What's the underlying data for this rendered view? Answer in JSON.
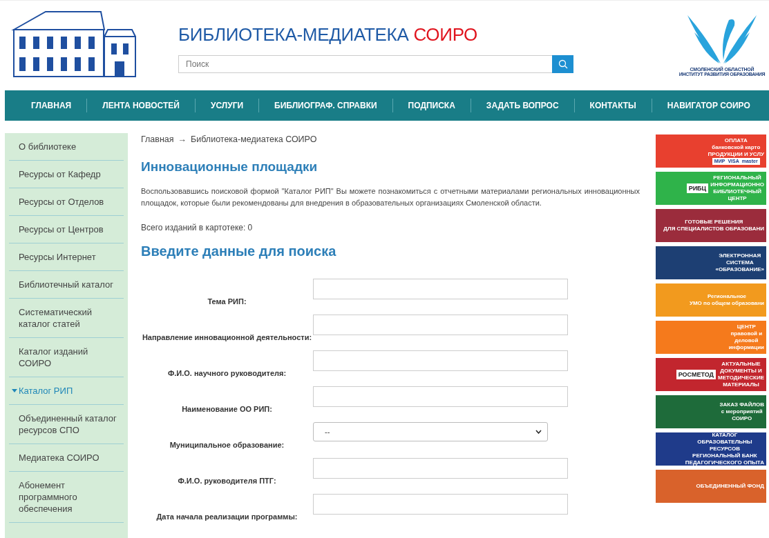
{
  "header": {
    "title": "БИБЛИОТЕКА-МЕДИАТЕКА",
    "title_accent": "СОИРО",
    "search": {
      "placeholder": "Поиск"
    },
    "org_lines": [
      "СМОЛЕНСКИЙ ОБЛАСТНОЙ",
      "ИНСТИТУТ РАЗВИТИЯ ОБРАЗОВАНИЯ"
    ]
  },
  "nav": [
    "ГЛАВНАЯ",
    "ЛЕНТА НОВОСТЕЙ",
    "УСЛУГИ",
    "БИБЛИОГРАФ. СПРАВКИ",
    "ПОДПИСКА",
    "ЗАДАТЬ ВОПРОС",
    "КОНТАКТЫ",
    "НАВИГАТОР СОИРО"
  ],
  "sidebar": {
    "items": [
      {
        "label": "О библиотеке",
        "selected": false
      },
      {
        "label": "Ресурсы от Кафедр",
        "selected": false
      },
      {
        "label": "Ресурсы от Отделов",
        "selected": false
      },
      {
        "label": "Ресурсы от Центров",
        "selected": false
      },
      {
        "label": "Ресурсы Интернет",
        "selected": false
      },
      {
        "label": "Библиотечный каталог",
        "selected": false
      },
      {
        "label": "Систематический каталог статей",
        "selected": false
      },
      {
        "label": "Каталог изданий СОИРО",
        "selected": false
      },
      {
        "label": "Каталог РИП",
        "selected": true
      },
      {
        "label": "Объединенный каталог ресурсов СПО",
        "selected": false
      },
      {
        "label": "Медиатека СОИРО",
        "selected": false
      },
      {
        "label": "Абонемент программного обеспечения",
        "selected": false
      }
    ]
  },
  "breadcrumb": [
    "Главная",
    "→",
    "Библиотека-медиатека СОИРО"
  ],
  "heading": "Инновационные площадки",
  "intro": "Воспользовавшись поисковой формой \"Каталог РИП\" Вы можете познакомиться с отчетными материалами региональных инновационных площадок, которые были рекомендованы для внедрения в образовательных организациях Смоленской области.",
  "count": "Всего изданий в картотеке: 0",
  "form": {
    "title": "Введите данные для поиска",
    "fields": [
      {
        "label": "Тема РИП:",
        "kind": "text"
      },
      {
        "label": "Направление инновационной деятельности:",
        "kind": "text"
      },
      {
        "label": "Ф.И.О. научного руководителя:",
        "kind": "text"
      },
      {
        "label": "Наименование ОО РИП:",
        "kind": "text"
      },
      {
        "label": "Муниципальное образование:",
        "kind": "select",
        "value": "--"
      },
      {
        "label": "Ф.И.О. руководителя ПТГ:",
        "kind": "text"
      },
      {
        "label": "Дата начала реализации программы:",
        "kind": "text"
      }
    ]
  },
  "banners": [
    {
      "color": "#e8402f",
      "lines": [
        "ОПЛАТА",
        "банковской карто",
        "ПРОДУКЦИИ И УСЛУ"
      ],
      "footer": [
        "МИР",
        "VISA",
        "master"
      ]
    },
    {
      "color": "#2fb34a",
      "lines": [
        "РЕГИОНАЛЬНЫЙ",
        "ИНФОРМАЦИОННО",
        "БИБЛИОТЕЧНЫЙ",
        "ЦЕНТР"
      ],
      "badge": "РИБЦ"
    },
    {
      "color": "#9b2c3c",
      "lines": [
        "ГОТОВЫЕ РЕШЕНИЯ",
        "ДЛЯ СПЕЦИАЛИСТОВ ОБРАЗОВАНИ"
      ]
    },
    {
      "color": "#1d3f73",
      "lines": [
        "ЭЛЕКТРОННАЯ",
        "СИСТЕМА",
        "«ОБРАЗОВАНИЕ»"
      ]
    },
    {
      "color": "#f29a1e",
      "lines": [
        "Региональное",
        "УМО по общем образовани"
      ]
    },
    {
      "color": "#f57a1c",
      "lines": [
        "ЦЕНТР",
        "правовой и",
        "деловой",
        "информации"
      ]
    },
    {
      "color": "#c2262e",
      "lines": [
        "АКТУАЛЬНЫЕ",
        "ДОКУМЕНТЫ И",
        "МЕТОДИЧЕСКИЕ",
        "МАТЕРИАЛЫ"
      ],
      "badge": "РОСМЕТОД"
    },
    {
      "color": "#1e6b3a",
      "lines": [
        "ЗАКАЗ ФАЙЛОВ",
        "с мероприятий",
        "СОИРО"
      ]
    },
    {
      "color": "#1f3b8a",
      "lines": [
        "КАТАЛОГ",
        "ОБРАЗОВАТЕЛЬНЫ",
        "РЕСУРСОВ",
        "РЕГИОНАЛЬНЫЙ БАНК",
        "ПЕДАГОГИЧЕСКОГО ОПЫТА"
      ]
    },
    {
      "color": "#d9622b",
      "lines": [
        "ОБЪЕДИНЕННЫЙ ФОНД"
      ]
    }
  ]
}
